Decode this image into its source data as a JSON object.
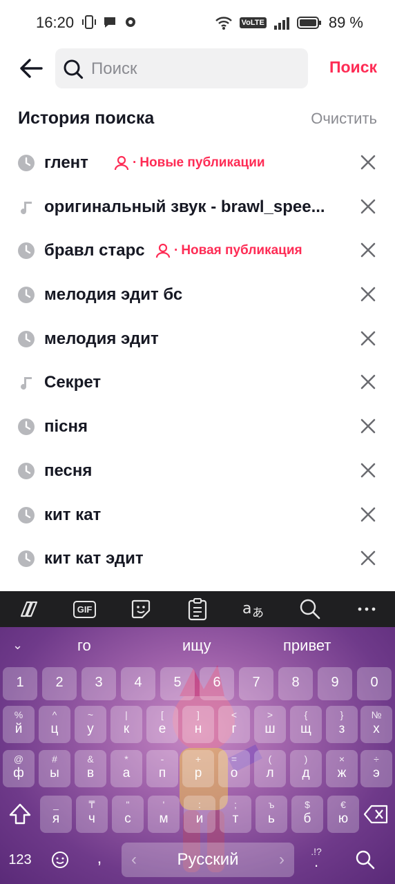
{
  "status": {
    "time": "16:20",
    "volte": "VoLTE",
    "battery": "89 %"
  },
  "search": {
    "placeholder": "Поиск",
    "button": "Поиск"
  },
  "history": {
    "title": "История поиска",
    "clear": "Очистить",
    "items": [
      {
        "icon": "clock-icon",
        "text": "глент",
        "badge": "Новые публикации"
      },
      {
        "icon": "music-note-icon",
        "text": "оригинальный звук - brawl_spee..."
      },
      {
        "icon": "clock-icon",
        "text": "бравл старс",
        "badge": "Новая публикация"
      },
      {
        "icon": "clock-icon",
        "text": "мелодия эдит бс"
      },
      {
        "icon": "clock-icon",
        "text": "мелодия эдит"
      },
      {
        "icon": "music-note-icon",
        "text": "Секрет"
      },
      {
        "icon": "clock-icon",
        "text": "пiсня"
      },
      {
        "icon": "clock-icon",
        "text": "песня"
      },
      {
        "icon": "clock-icon",
        "text": "кит кат"
      },
      {
        "icon": "clock-icon",
        "text": "кит кат эдит"
      }
    ]
  },
  "keyboard": {
    "toolbar": [
      "copilot-icon",
      "gif-icon",
      "sticker-icon",
      "clipboard-icon",
      "translate-icon",
      "search-icon",
      "more-icon"
    ],
    "gif_label": "GIF",
    "suggestions": [
      "го",
      "ищу",
      "привет"
    ],
    "numbers": [
      "1",
      "2",
      "3",
      "4",
      "5",
      "6",
      "7",
      "8",
      "9",
      "0"
    ],
    "row1": [
      [
        "%",
        "й"
      ],
      [
        "^",
        "ц"
      ],
      [
        "~",
        "у"
      ],
      [
        "|",
        "к"
      ],
      [
        "[",
        "е"
      ],
      [
        "]",
        "н"
      ],
      [
        "<",
        "г"
      ],
      [
        ">",
        "ш"
      ],
      [
        "{",
        "щ"
      ],
      [
        "}",
        "з"
      ],
      [
        "№",
        "х"
      ]
    ],
    "row2": [
      [
        "@",
        "ф"
      ],
      [
        "#",
        "ы"
      ],
      [
        "&",
        "в"
      ],
      [
        "*",
        "а"
      ],
      [
        "-",
        "п"
      ],
      [
        "+",
        "р"
      ],
      [
        "=",
        "о"
      ],
      [
        "(",
        "л"
      ],
      [
        ")",
        "д"
      ],
      [
        "×",
        "ж"
      ],
      [
        "÷",
        "э"
      ]
    ],
    "row3": [
      [
        "_",
        "я"
      ],
      [
        "₸",
        "ч"
      ],
      [
        "\"",
        "с"
      ],
      [
        "'",
        "м"
      ],
      [
        ":",
        "и"
      ],
      [
        ";",
        "т"
      ],
      [
        "ъ",
        "ь"
      ],
      [
        "$",
        "б"
      ],
      [
        "€",
        "ю"
      ]
    ],
    "label_123": "123",
    "comma": ",",
    "space": "Русский",
    "punct": ".!?",
    "period": "."
  },
  "colors": {
    "accent": "#fe2c55",
    "muted": "#8a8b91"
  }
}
